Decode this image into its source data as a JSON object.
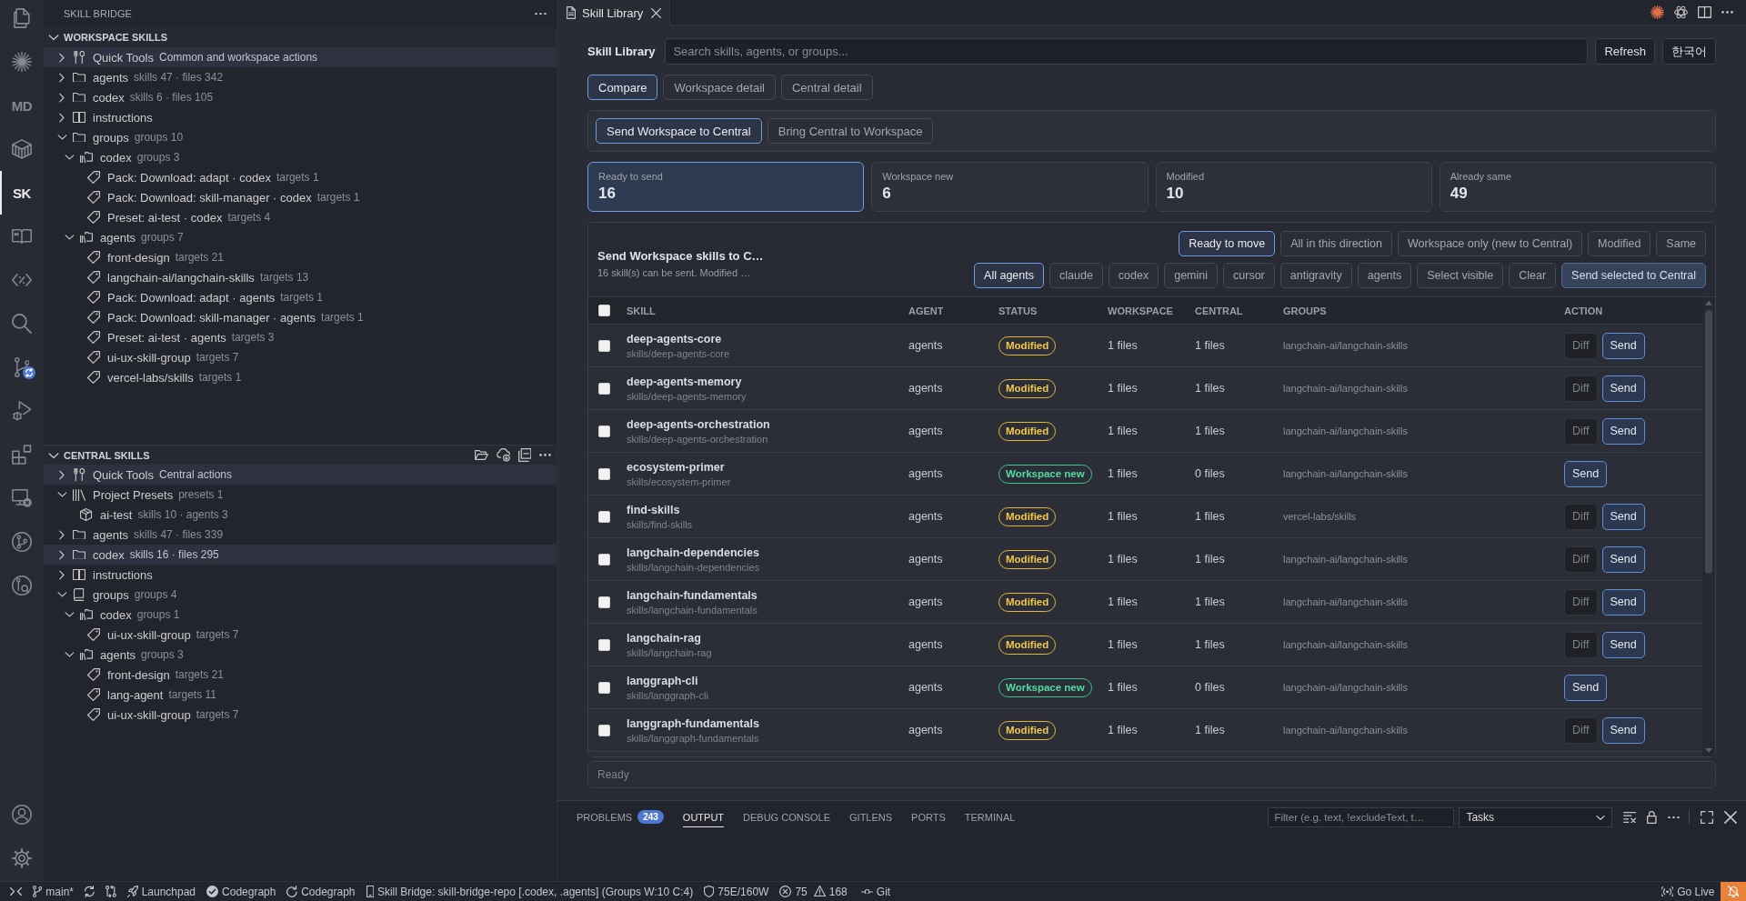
{
  "activity_bar": {
    "items": [
      {
        "kind": "files",
        "selected": false
      },
      {
        "kind": "sparkle",
        "selected": false
      },
      {
        "kind": "text",
        "label": "MD",
        "selected": false
      },
      {
        "kind": "box",
        "selected": false
      },
      {
        "kind": "text",
        "label": "SK",
        "selected": true
      },
      {
        "kind": "book",
        "selected": false
      },
      {
        "kind": "code",
        "selected": false
      },
      {
        "kind": "search",
        "selected": false
      },
      {
        "kind": "source-control",
        "selected": false
      },
      {
        "kind": "run-debug",
        "selected": false
      },
      {
        "kind": "extensions",
        "selected": false
      },
      {
        "kind": "remote",
        "selected": false
      },
      {
        "kind": "git-graph",
        "selected": false
      },
      {
        "kind": "git-inspect",
        "selected": false
      }
    ],
    "bottom": [
      {
        "kind": "account"
      },
      {
        "kind": "settings"
      }
    ]
  },
  "sidebar": {
    "title": "SKILL BRIDGE",
    "sections": [
      {
        "title": "WORKSPACE SKILLS",
        "expanded": true,
        "items": [
          {
            "label": "Quick Tools",
            "detail": "Common and workspace actions",
            "kind": "tools",
            "expanded": false,
            "selected": true
          },
          {
            "label": "agents",
            "detail": "skills 47 · files 342",
            "kind": "folder",
            "expanded": false,
            "selected": false
          },
          {
            "label": "codex",
            "detail": "skills 6 · files 105",
            "kind": "folder",
            "expanded": false,
            "selected": false
          },
          {
            "label": "instructions",
            "kind": "book",
            "expanded": false,
            "selected": false
          },
          {
            "label": "groups",
            "detail": "groups 10",
            "kind": "folder",
            "expanded": true,
            "selected": false,
            "children": [
              {
                "label": "codex",
                "detail": "groups 3",
                "kind": "shelf",
                "expanded": true,
                "selected": false,
                "children": [
                  {
                    "label": "Pack: Download: adapt · codex",
                    "detail": "targets 1",
                    "kind": "tag",
                    "selected": false
                  },
                  {
                    "label": "Pack: Download: skill-manager · codex",
                    "detail": "targets 1",
                    "kind": "tag",
                    "selected": false
                  },
                  {
                    "label": "Preset: ai-test · codex",
                    "detail": "targets 4",
                    "kind": "tag",
                    "selected": false
                  }
                ]
              },
              {
                "label": "agents",
                "detail": "groups 7",
                "kind": "shelf",
                "expanded": true,
                "selected": false,
                "children": [
                  {
                    "label": "front-design",
                    "detail": "targets 21",
                    "kind": "tag",
                    "selected": false
                  },
                  {
                    "label": "langchain-ai/langchain-skills",
                    "detail": "targets 13",
                    "kind": "tag",
                    "selected": false
                  },
                  {
                    "label": "Pack: Download: adapt · agents",
                    "detail": "targets 1",
                    "kind": "tag",
                    "selected": false
                  },
                  {
                    "label": "Pack: Download: skill-manager · agents",
                    "detail": "targets 1",
                    "kind": "tag",
                    "selected": false
                  },
                  {
                    "label": "Preset: ai-test · agents",
                    "detail": "targets 3",
                    "kind": "tag",
                    "selected": false
                  },
                  {
                    "label": "ui-ux-skill-group",
                    "detail": "targets 7",
                    "kind": "tag",
                    "selected": false
                  },
                  {
                    "label": "vercel-labs/skills",
                    "detail": "targets 1",
                    "kind": "tag",
                    "selected": false
                  }
                ]
              }
            ]
          }
        ]
      },
      {
        "title": "CENTRAL SKILLS",
        "expanded": true,
        "actions": [
          {
            "kind": "open-folder"
          },
          {
            "kind": "download"
          },
          {
            "kind": "collapse"
          },
          {
            "kind": "more"
          }
        ],
        "items": [
          {
            "label": "Quick Tools",
            "detail": "Central actions",
            "kind": "tools",
            "expanded": false,
            "selected": true
          },
          {
            "label": "Project Presets",
            "detail": "presets 1",
            "kind": "library",
            "expanded": true,
            "selected": false,
            "children": [
              {
                "label": "ai-test",
                "detail": "skills 10 · agents 3",
                "kind": "package",
                "selected": false
              }
            ]
          },
          {
            "label": "agents",
            "detail": "skills 47 · files 339",
            "kind": "folder",
            "expanded": false,
            "selected": false
          },
          {
            "label": "codex",
            "detail": "skills 16 · files 295",
            "kind": "folder",
            "expanded": false,
            "selected": true
          },
          {
            "label": "instructions",
            "kind": "book",
            "expanded": false,
            "selected": false
          },
          {
            "label": "groups",
            "detail": "groups 4",
            "kind": "notebook",
            "expanded": true,
            "selected": false,
            "children": [
              {
                "label": "codex",
                "detail": "groups 1",
                "kind": "shelf",
                "expanded": true,
                "selected": false,
                "children": [
                  {
                    "label": "ui-ux-skill-group",
                    "detail": "targets 7",
                    "kind": "tag",
                    "selected": false
                  }
                ]
              },
              {
                "label": "agents",
                "detail": "groups 3",
                "kind": "shelf",
                "expanded": true,
                "selected": false,
                "children": [
                  {
                    "label": "front-design",
                    "detail": "targets 21",
                    "kind": "tag",
                    "selected": false
                  },
                  {
                    "label": "lang-agent",
                    "detail": "targets 11",
                    "kind": "tag",
                    "selected": false
                  },
                  {
                    "label": "ui-ux-skill-group",
                    "detail": "targets 7",
                    "kind": "tag",
                    "selected": false
                  }
                ]
              }
            ]
          }
        ]
      }
    ]
  },
  "editor": {
    "tabs": [
      {
        "label": "Skill Library",
        "selected": true
      }
    ],
    "actions": [
      {
        "kind": "burst"
      },
      {
        "kind": "knot"
      },
      {
        "kind": "split"
      },
      {
        "kind": "more"
      }
    ]
  },
  "library": {
    "title": "Skill Library",
    "search": {
      "placeholder": "Search skills, agents, or groups..."
    },
    "refresh": "Refresh",
    "language": "한국어",
    "views": [
      {
        "label": "Compare",
        "selected": true
      },
      {
        "label": "Workspace detail",
        "selected": false
      },
      {
        "label": "Central detail",
        "selected": false
      }
    ],
    "directions": [
      {
        "label": "Send Workspace to Central",
        "selected": true
      },
      {
        "label": "Bring Central to Workspace",
        "selected": false
      }
    ],
    "stats": [
      {
        "label": "Ready to send",
        "value": "16",
        "selected": true
      },
      {
        "label": "Workspace new",
        "value": "6",
        "selected": false
      },
      {
        "label": "Modified",
        "value": "10",
        "selected": false
      },
      {
        "label": "Already same",
        "value": "49",
        "selected": false
      }
    ],
    "compare": {
      "title": "Send Workspace skills to C…",
      "subtitle": "16 skill(s) can be sent. Modified …",
      "status_filters": [
        {
          "label": "Ready to move",
          "selected": true
        },
        {
          "label": "All in this direction",
          "selected": false
        },
        {
          "label": "Workspace only (new to Central)",
          "selected": false
        },
        {
          "label": "Modified",
          "selected": false
        },
        {
          "label": "Same",
          "selected": false
        }
      ],
      "agent_filters": [
        {
          "label": "All agents",
          "selected": true
        },
        {
          "label": "claude",
          "selected": false
        },
        {
          "label": "codex",
          "selected": false
        },
        {
          "label": "gemini",
          "selected": false
        },
        {
          "label": "cursor",
          "selected": false
        },
        {
          "label": "antigravity",
          "selected": false
        },
        {
          "label": "agents",
          "selected": false
        }
      ],
      "actions": [
        {
          "label": "Select visible",
          "kind": "select"
        },
        {
          "label": "Clear",
          "kind": "clear"
        },
        {
          "label": "Send selected to Central",
          "kind": "send"
        }
      ],
      "table": {
        "select_all": {
          "checked": false
        },
        "columns": [
          "SKILL",
          "AGENT",
          "STATUS",
          "WORKSPACE",
          "CENTRAL",
          "GROUPS",
          "ACTION"
        ],
        "rows": [
          {
            "checked": false,
            "skill": "deep-agents-core",
            "path": "skills/deep-agents-core",
            "agent": "agents",
            "status": {
              "label": "Modified",
              "kind": "modified"
            },
            "workspace": "1 files",
            "central": "1 files",
            "groups": "langchain-ai/langchain-skills",
            "actions": [
              {
                "label": "Diff",
                "kind": "diff"
              },
              {
                "label": "Send",
                "kind": "send"
              }
            ]
          },
          {
            "checked": false,
            "skill": "deep-agents-memory",
            "path": "skills/deep-agents-memory",
            "agent": "agents",
            "status": {
              "label": "Modified",
              "kind": "modified"
            },
            "workspace": "1 files",
            "central": "1 files",
            "groups": "langchain-ai/langchain-skills",
            "actions": [
              {
                "label": "Diff",
                "kind": "diff"
              },
              {
                "label": "Send",
                "kind": "send"
              }
            ]
          },
          {
            "checked": false,
            "skill": "deep-agents-orchestration",
            "path": "skills/deep-agents-orchestration",
            "agent": "agents",
            "status": {
              "label": "Modified",
              "kind": "modified"
            },
            "workspace": "1 files",
            "central": "1 files",
            "groups": "langchain-ai/langchain-skills",
            "actions": [
              {
                "label": "Diff",
                "kind": "diff"
              },
              {
                "label": "Send",
                "kind": "send"
              }
            ]
          },
          {
            "checked": false,
            "skill": "ecosystem-primer",
            "path": "skills/ecosystem-primer",
            "agent": "agents",
            "status": {
              "label": "Workspace new",
              "kind": "new"
            },
            "workspace": "1 files",
            "central": "0 files",
            "groups": "langchain-ai/langchain-skills",
            "actions": [
              {
                "label": "Send",
                "kind": "send"
              }
            ]
          },
          {
            "checked": false,
            "skill": "find-skills",
            "path": "skills/find-skills",
            "agent": "agents",
            "status": {
              "label": "Modified",
              "kind": "modified"
            },
            "workspace": "1 files",
            "central": "1 files",
            "groups": "vercel-labs/skills",
            "actions": [
              {
                "label": "Diff",
                "kind": "diff"
              },
              {
                "label": "Send",
                "kind": "send"
              }
            ]
          },
          {
            "checked": false,
            "skill": "langchain-dependencies",
            "path": "skills/langchain-dependencies",
            "agent": "agents",
            "status": {
              "label": "Modified",
              "kind": "modified"
            },
            "workspace": "1 files",
            "central": "1 files",
            "groups": "langchain-ai/langchain-skills",
            "actions": [
              {
                "label": "Diff",
                "kind": "diff"
              },
              {
                "label": "Send",
                "kind": "send"
              }
            ]
          },
          {
            "checked": false,
            "skill": "langchain-fundamentals",
            "path": "skills/langchain-fundamentals",
            "agent": "agents",
            "status": {
              "label": "Modified",
              "kind": "modified"
            },
            "workspace": "1 files",
            "central": "1 files",
            "groups": "langchain-ai/langchain-skills",
            "actions": [
              {
                "label": "Diff",
                "kind": "diff"
              },
              {
                "label": "Send",
                "kind": "send"
              }
            ]
          },
          {
            "checked": false,
            "skill": "langchain-rag",
            "path": "skills/langchain-rag",
            "agent": "agents",
            "status": {
              "label": "Modified",
              "kind": "modified"
            },
            "workspace": "1 files",
            "central": "1 files",
            "groups": "langchain-ai/langchain-skills",
            "actions": [
              {
                "label": "Diff",
                "kind": "diff"
              },
              {
                "label": "Send",
                "kind": "send"
              }
            ]
          },
          {
            "checked": false,
            "skill": "langgraph-cli",
            "path": "skills/langgraph-cli",
            "agent": "agents",
            "status": {
              "label": "Workspace new",
              "kind": "new"
            },
            "workspace": "1 files",
            "central": "0 files",
            "groups": "langchain-ai/langchain-skills",
            "actions": [
              {
                "label": "Send",
                "kind": "send"
              }
            ]
          },
          {
            "checked": false,
            "skill": "langgraph-fundamentals",
            "path": "skills/langgraph-fundamentals",
            "agent": "agents",
            "status": {
              "label": "Modified",
              "kind": "modified"
            },
            "workspace": "1 files",
            "central": "1 files",
            "groups": "langchain-ai/langchain-skills",
            "actions": [
              {
                "label": "Diff",
                "kind": "diff"
              },
              {
                "label": "Send",
                "kind": "send"
              }
            ]
          }
        ]
      }
    },
    "message": "Ready"
  },
  "panel": {
    "tabs": [
      {
        "label": "PROBLEMS",
        "badge": "243",
        "selected": false
      },
      {
        "label": "OUTPUT",
        "selected": true
      },
      {
        "label": "DEBUG CONSOLE",
        "selected": false
      },
      {
        "label": "GITLENS",
        "selected": false
      },
      {
        "label": "PORTS",
        "selected": false
      },
      {
        "label": "TERMINAL",
        "selected": false
      }
    ],
    "filter": {
      "placeholder": "Filter (e.g. text, !excludeText, t…"
    },
    "dropdown": {
      "value": "Tasks"
    },
    "actions": [
      {
        "kind": "filter-list"
      },
      {
        "kind": "lock"
      },
      {
        "kind": "more"
      },
      {
        "kind": "maximize"
      },
      {
        "kind": "close"
      }
    ]
  },
  "status_bar": {
    "left": [
      {
        "kind": "remote"
      },
      {
        "kind": "branch",
        "label": "main*"
      },
      {
        "kind": "sync"
      },
      {
        "kind": "compare"
      },
      {
        "kind": "launchpad",
        "label": "Launchpad"
      },
      {
        "kind": "check",
        "label": "Codegraph"
      },
      {
        "kind": "refresh",
        "label": "Codegraph"
      },
      {
        "kind": "device",
        "label": "Skill Bridge: skill-bridge-repo [.codex, .agents] (Groups W:10 C:4)"
      },
      {
        "kind": "shield",
        "label": "75E/160W"
      },
      {
        "kind": "problems",
        "errors": "75",
        "warnings": "168"
      },
      {
        "kind": "commit",
        "label": "Git"
      }
    ],
    "right": [
      {
        "kind": "broadcast",
        "label": "Go Live"
      },
      {
        "kind": "bell"
      }
    ]
  }
}
